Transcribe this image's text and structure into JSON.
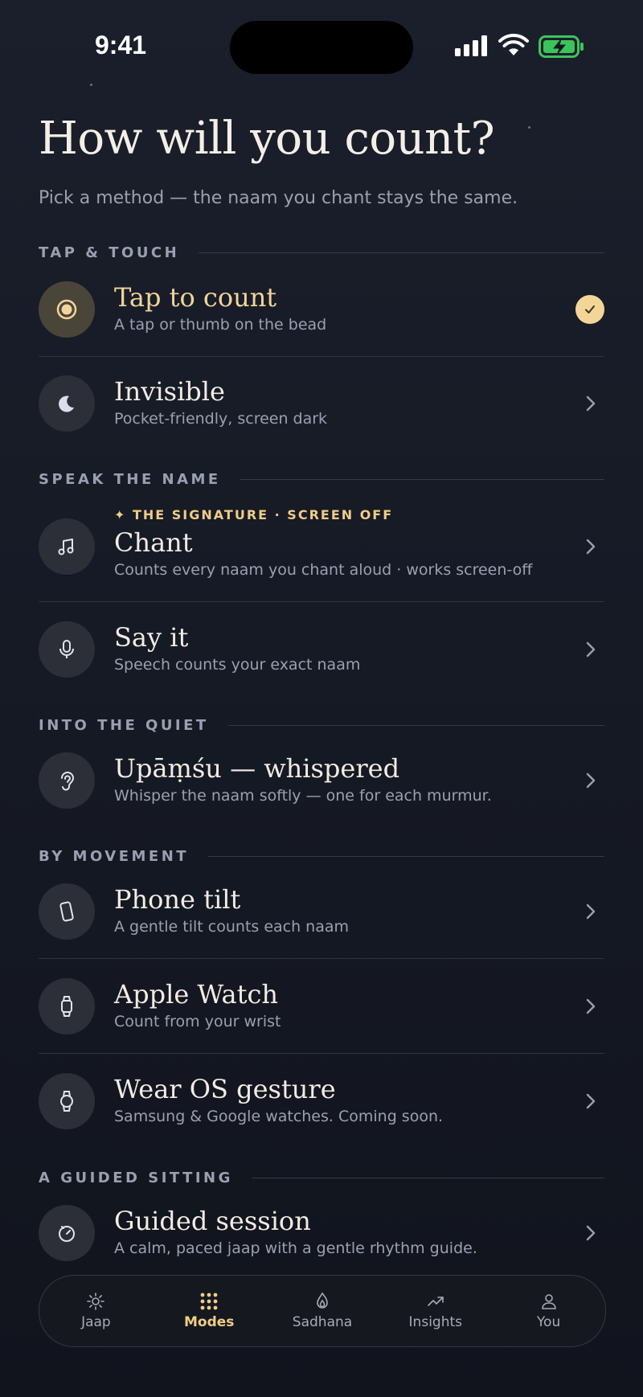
{
  "status_bar": {
    "time": "9:41"
  },
  "header": {
    "title": "How will you count?",
    "subtitle": "Pick a method — the naam you chant stays the same."
  },
  "sections": {
    "tap_touch": "TAP & TOUCH",
    "speak": "SPEAK THE NAME",
    "quiet": "INTO THE QUIET",
    "movement": "BY MOVEMENT",
    "guided": "A GUIDED SITTING"
  },
  "modes": {
    "tap": {
      "label": "Tap to count",
      "desc": "A tap or thumb on the bead",
      "selected": true,
      "icon": "radio-dot-icon"
    },
    "invisible": {
      "label": "Invisible",
      "desc": "Pocket-friendly, screen dark",
      "icon": "moon-icon"
    },
    "chant": {
      "eyebrow": "✦ THE SIGNATURE · SCREEN OFF",
      "label": "Chant",
      "desc": "Counts every naam you chant aloud · works screen-off",
      "icon": "music-note-icon"
    },
    "say": {
      "label": "Say it",
      "desc": "Speech counts your exact naam",
      "icon": "microphone-icon"
    },
    "upamsu": {
      "label": "Upāṃśu — whispered",
      "desc": "Whisper the naam softly — one for each murmur.",
      "icon": "ear-icon"
    },
    "tilt": {
      "label": "Phone tilt",
      "desc": "A gentle tilt counts each naam",
      "icon": "phone-icon"
    },
    "watch": {
      "label": "Apple Watch",
      "desc": "Count from your wrist",
      "icon": "watch-icon"
    },
    "wearos": {
      "label": "Wear OS gesture",
      "desc": "Samsung & Google watches. Coming soon.",
      "icon": "round-watch-icon"
    },
    "guided": {
      "label": "Guided session",
      "desc": "A calm, paced jaap with a gentle rhythm guide.",
      "icon": "timer-icon"
    }
  },
  "tabbar": {
    "tabs": [
      {
        "label": "Jaap",
        "icon": "sun-icon"
      },
      {
        "label": "Modes",
        "icon": "grid-dots-icon",
        "active": true
      },
      {
        "label": "Sadhana",
        "icon": "flame-icon"
      },
      {
        "label": "Insights",
        "icon": "trend-up-icon"
      },
      {
        "label": "You",
        "icon": "person-icon"
      }
    ]
  },
  "colors": {
    "background": "#161a25",
    "accent_gold": "#f0cd86",
    "text_primary": "#f1ece3",
    "text_secondary": "#9aa0b0",
    "battery_green": "#3cc45a"
  }
}
